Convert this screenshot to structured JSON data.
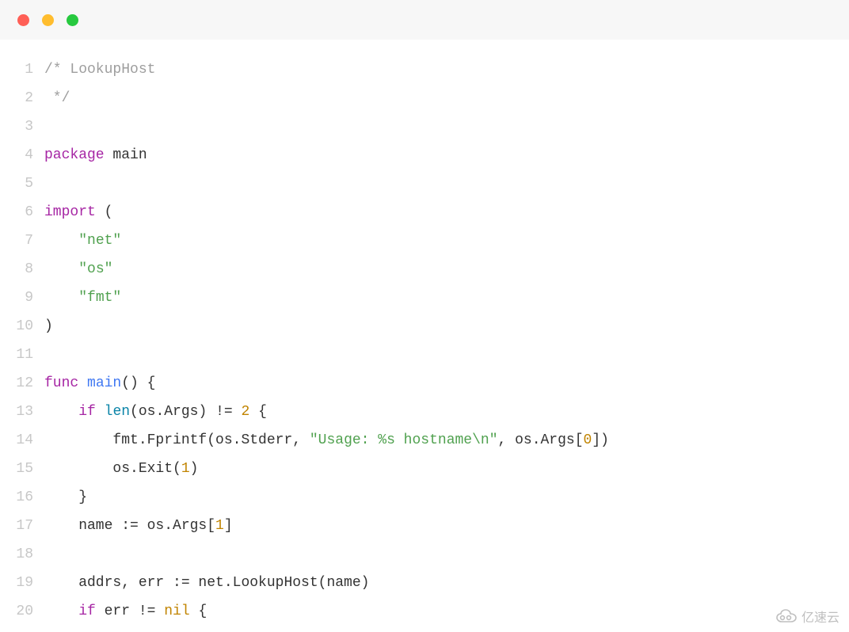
{
  "window": {
    "traffic_lights": [
      "red",
      "yellow",
      "green"
    ]
  },
  "code": {
    "language": "go",
    "lines": [
      {
        "n": 1,
        "tokens": [
          {
            "t": "/* LookupHost",
            "c": "cm"
          }
        ]
      },
      {
        "n": 2,
        "tokens": [
          {
            "t": " */",
            "c": "cm"
          }
        ]
      },
      {
        "n": 3,
        "tokens": [
          {
            "t": "",
            "c": "pn"
          }
        ]
      },
      {
        "n": 4,
        "tokens": [
          {
            "t": "package",
            "c": "kw"
          },
          {
            "t": " main",
            "c": "pn"
          }
        ]
      },
      {
        "n": 5,
        "tokens": [
          {
            "t": "",
            "c": "pn"
          }
        ]
      },
      {
        "n": 6,
        "tokens": [
          {
            "t": "import",
            "c": "kw"
          },
          {
            "t": " (",
            "c": "pn"
          }
        ]
      },
      {
        "n": 7,
        "tokens": [
          {
            "t": "    ",
            "c": "pn"
          },
          {
            "t": "\"net\"",
            "c": "st"
          }
        ]
      },
      {
        "n": 8,
        "tokens": [
          {
            "t": "    ",
            "c": "pn"
          },
          {
            "t": "\"os\"",
            "c": "st"
          }
        ]
      },
      {
        "n": 9,
        "tokens": [
          {
            "t": "    ",
            "c": "pn"
          },
          {
            "t": "\"fmt\"",
            "c": "st"
          }
        ]
      },
      {
        "n": 10,
        "tokens": [
          {
            "t": ")",
            "c": "pn"
          }
        ]
      },
      {
        "n": 11,
        "tokens": [
          {
            "t": "",
            "c": "pn"
          }
        ]
      },
      {
        "n": 12,
        "tokens": [
          {
            "t": "func",
            "c": "kw"
          },
          {
            "t": " ",
            "c": "pn"
          },
          {
            "t": "main",
            "c": "fn"
          },
          {
            "t": "()",
            "c": "pn"
          },
          {
            "t": " {",
            "c": "pn"
          }
        ]
      },
      {
        "n": 13,
        "tokens": [
          {
            "t": "    ",
            "c": "pn"
          },
          {
            "t": "if",
            "c": "kw"
          },
          {
            "t": " ",
            "c": "pn"
          },
          {
            "t": "len",
            "c": "bi"
          },
          {
            "t": "(os.Args) != ",
            "c": "pn"
          },
          {
            "t": "2",
            "c": "nm"
          },
          {
            "t": " {",
            "c": "pn"
          }
        ]
      },
      {
        "n": 14,
        "tokens": [
          {
            "t": "        fmt.Fprintf(os.Stderr, ",
            "c": "pn"
          },
          {
            "t": "\"Usage: %s hostname\\n\"",
            "c": "st"
          },
          {
            "t": ", os.Args[",
            "c": "pn"
          },
          {
            "t": "0",
            "c": "nm"
          },
          {
            "t": "])",
            "c": "pn"
          }
        ]
      },
      {
        "n": 15,
        "tokens": [
          {
            "t": "        os.Exit(",
            "c": "pn"
          },
          {
            "t": "1",
            "c": "nm"
          },
          {
            "t": ")",
            "c": "pn"
          }
        ]
      },
      {
        "n": 16,
        "tokens": [
          {
            "t": "    }",
            "c": "pn"
          }
        ]
      },
      {
        "n": 17,
        "tokens": [
          {
            "t": "    name := os.Args[",
            "c": "pn"
          },
          {
            "t": "1",
            "c": "nm"
          },
          {
            "t": "]",
            "c": "pn"
          }
        ]
      },
      {
        "n": 18,
        "tokens": [
          {
            "t": "",
            "c": "pn"
          }
        ]
      },
      {
        "n": 19,
        "tokens": [
          {
            "t": "    addrs, err := net.LookupHost(name)",
            "c": "pn"
          }
        ]
      },
      {
        "n": 20,
        "tokens": [
          {
            "t": "    ",
            "c": "pn"
          },
          {
            "t": "if",
            "c": "kw"
          },
          {
            "t": " err != ",
            "c": "pn"
          },
          {
            "t": "nil",
            "c": "nl"
          },
          {
            "t": " {",
            "c": "pn"
          }
        ]
      }
    ]
  },
  "watermark": {
    "text": "亿速云"
  }
}
